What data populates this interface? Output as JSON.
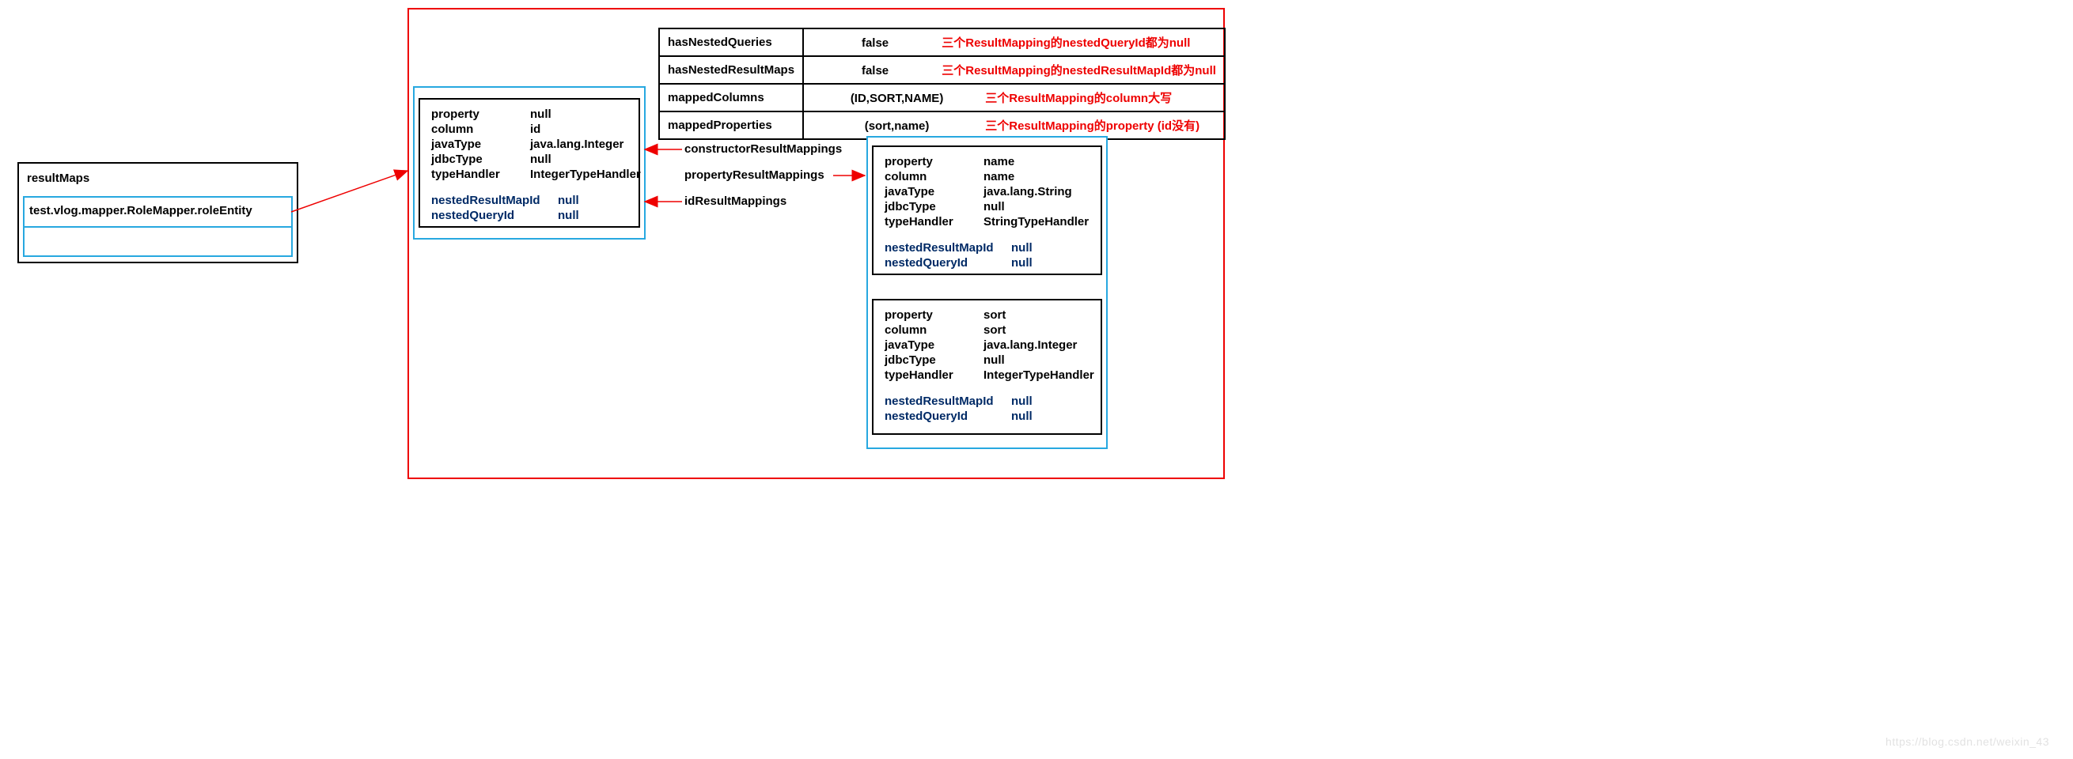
{
  "left_box": {
    "title": "resultMaps",
    "entry": "test.vlog.mapper.RoleMapper.roleEntity"
  },
  "summary": {
    "rows": [
      {
        "key": "hasNestedQueries",
        "val": "false",
        "note": "三个ResultMapping的nestedQueryId都为null"
      },
      {
        "key": "hasNestedResultMaps",
        "val": "false",
        "note": "三个ResultMapping的nestedResultMapId都为null"
      },
      {
        "key": "mappedColumns",
        "val": "(ID,SORT,NAME)",
        "note": "三个ResultMapping的column大写"
      },
      {
        "key": "mappedProperties",
        "val": "(sort,name)",
        "note": "三个ResultMapping的property (id没有)"
      }
    ]
  },
  "id_mapping": {
    "property": "null",
    "column": "id",
    "javaType": "java.lang.Integer",
    "jdbcType": "null",
    "typeHandler": "IntegerTypeHandler",
    "nestedResultMapId": "null",
    "nestedQueryId": "null"
  },
  "prop_mappings": {
    "name": {
      "property": "name",
      "column": "name",
      "javaType": "java.lang.String",
      "jdbcType": "null",
      "typeHandler": "StringTypeHandler",
      "nestedResultMapId": "null",
      "nestedQueryId": "null"
    },
    "sort": {
      "property": "sort",
      "column": "sort",
      "javaType": "java.lang.Integer",
      "jdbcType": "null",
      "typeHandler": "IntegerTypeHandler",
      "nestedResultMapId": "null",
      "nestedQueryId": "null"
    }
  },
  "arrows": {
    "constructor": "constructorResultMappings",
    "property": "propertyResultMappings",
    "id": "idResultMappings"
  },
  "field_labels": {
    "property": "property",
    "column": "column",
    "javaType": "javaType",
    "jdbcType": "jdbcType",
    "typeHandler": "typeHandler",
    "nestedResultMapId": "nestedResultMapId",
    "nestedQueryId": "nestedQueryId"
  },
  "watermark": "https://blog.csdn.net/weixin_43"
}
